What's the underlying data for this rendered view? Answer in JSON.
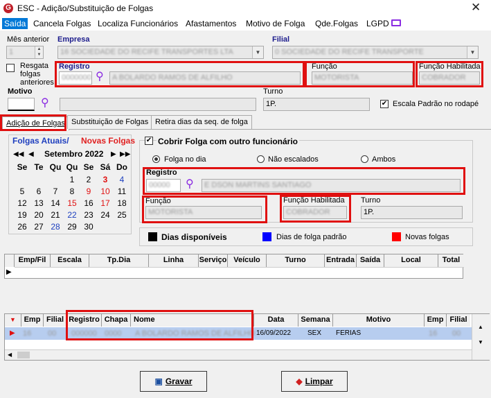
{
  "window": {
    "icon_letter": "G",
    "title": "ESC  -  Adição/Substituição de Folgas",
    "close": "✕"
  },
  "menu": [
    "Saída",
    "Cancela Folgas",
    "Localiza Funcionários",
    "Afastamentos",
    "Motivo de Folga",
    "Qde.Folgas",
    "LGPD"
  ],
  "top": {
    "mes_label": "Mês anterior",
    "mes_value": "1",
    "empresa_label": "Empresa",
    "empresa_value": "16 SOCIEDADE DO RECIFE TRANSPORTES LTA",
    "filial_label": "Filial",
    "filial_value": "0 SOCIEDADE DO RECIFE TRANSPORTE",
    "resgata_label": "Resgata folgas anteriores",
    "registro_label": "Registro",
    "registro_value": "0000000",
    "registro_name": "A BOLARDO RAMOS DE ALFILHO",
    "funcao_label": "Função",
    "funcao_value": "MOTORISTA",
    "funcao_hab_label": "Função Habilitada",
    "funcao_hab_value": "COBRADOR",
    "motivo_label": "Motivo",
    "motivo_value": "",
    "turno_label": "Turno",
    "turno_value": "1P.",
    "escala_label": "Escala Padrão no rodapé"
  },
  "tabs": [
    "Adição de Folgas",
    "Substituição de Folgas",
    "Retira dias da seq. de folga"
  ],
  "calendar": {
    "header_a": "Folgas Atuais/",
    "header_b": "Novas Folgas",
    "month": "Setembro 2022",
    "weekdays": [
      "Se",
      "Te",
      "Qu",
      "Qu",
      "Se",
      "Sá",
      "Do"
    ],
    "rows": [
      [
        "",
        "",
        "",
        "1",
        "2",
        "3",
        "4"
      ],
      [
        "5",
        "6",
        "7",
        "8",
        "9",
        "10",
        "11"
      ],
      [
        "12",
        "13",
        "14",
        "15",
        "16",
        "17",
        "18"
      ],
      [
        "19",
        "20",
        "21",
        "22",
        "23",
        "24",
        "25"
      ],
      [
        "26",
        "27",
        "28",
        "29",
        "30",
        "",
        ""
      ]
    ]
  },
  "cobrir": {
    "label": "Cobrir Folga com outro funcionário",
    "radio_1": "Folga no dia",
    "radio_2": "Não escalados",
    "radio_3": "Ambos",
    "registro_label": "Registro",
    "registro_value": "00000",
    "registro_name": "E DSON MARTINS SANTIAGO",
    "funcao_label": "Função",
    "funcao_value": "MOTORISTA",
    "funcao_hab_label": "Função Habilitada",
    "funcao_hab_value": "COBRADOR",
    "turno_label": "Turno",
    "turno_value": "1P."
  },
  "legend": {
    "disp": "Dias disponíveis",
    "padrao": "Dias de folga padrão",
    "novas": "Novas folgas"
  },
  "grid1": {
    "headers": [
      "Emp/Fil",
      "Escala",
      "Tp.Dia",
      "Linha",
      "Serviço",
      "Veículo",
      "Turno",
      "Entrada",
      "Saída",
      "Local",
      "Total"
    ]
  },
  "grid2": {
    "headers": [
      "Emp",
      "Filial",
      "Registro",
      "Chapa",
      "Nome",
      "Data",
      "Semana",
      "Motivo",
      "Emp",
      "Filial"
    ],
    "row": [
      "16",
      "00",
      "000000",
      "0000",
      "A BOLARDO RAMOS DE ALFILHO",
      "16/09/2022",
      "SEX",
      "FERIAS",
      "16",
      "00"
    ]
  },
  "buttons": {
    "gravar": "Gravar",
    "limpar": "Limpar"
  },
  "colors": {
    "red_box": "#e01010",
    "selection": "#0078d7",
    "legend_black": "#000000",
    "legend_blue": "#0000ff",
    "legend_red": "#ff0000"
  }
}
